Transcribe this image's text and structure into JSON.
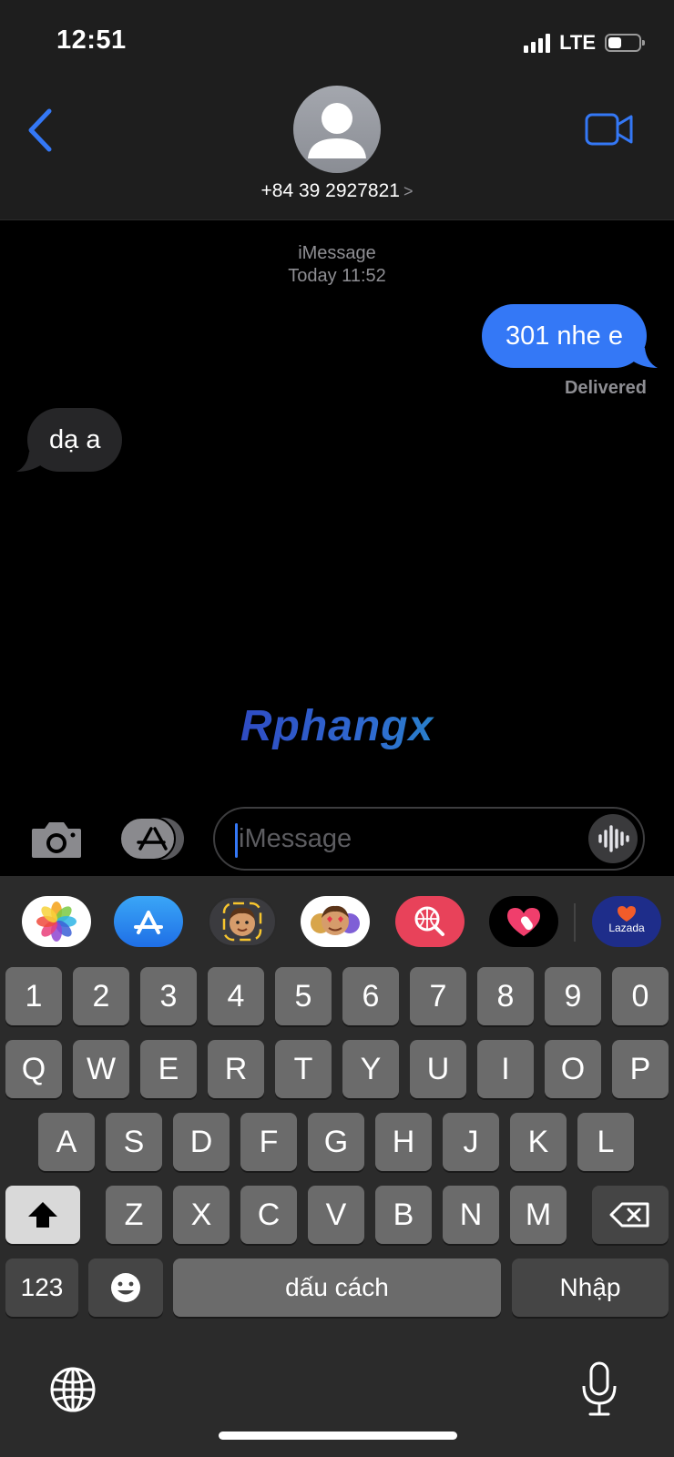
{
  "status_bar": {
    "time": "12:51",
    "network": "LTE"
  },
  "header": {
    "contact_number": "+84 39 2927821",
    "chevron": ">",
    "icons": [
      "back-chevron-icon",
      "video-call-icon",
      "contact-avatar-icon"
    ]
  },
  "conversation": {
    "service": "iMessage",
    "timestamp": "Today 11:52",
    "messages": [
      {
        "direction": "outgoing",
        "text": "301 nhe e",
        "status": "Delivered"
      },
      {
        "direction": "incoming",
        "text": "dạ a"
      }
    ],
    "watermark": "Rphangx"
  },
  "composer": {
    "placeholder": "iMessage",
    "icons": [
      "camera-icon",
      "app-store-icon",
      "audio-waveform-icon"
    ]
  },
  "app_strip": {
    "apps": [
      {
        "name": "photos",
        "label": ""
      },
      {
        "name": "app-store",
        "label": ""
      },
      {
        "name": "memoji",
        "label": ""
      },
      {
        "name": "memoji-stickers",
        "label": ""
      },
      {
        "name": "web-images",
        "label": ""
      },
      {
        "name": "digital-touch",
        "label": ""
      },
      {
        "name": "lazada",
        "label": "Lazada"
      }
    ]
  },
  "keyboard": {
    "row_numbers": [
      "1",
      "2",
      "3",
      "4",
      "5",
      "6",
      "7",
      "8",
      "9",
      "0"
    ],
    "row_top": [
      "Q",
      "W",
      "E",
      "R",
      "T",
      "Y",
      "U",
      "I",
      "O",
      "P"
    ],
    "row_middle": [
      "A",
      "S",
      "D",
      "F",
      "G",
      "H",
      "J",
      "K",
      "L"
    ],
    "row_bottom": [
      "Z",
      "X",
      "C",
      "V",
      "B",
      "N",
      "M"
    ],
    "numbers_key": "123",
    "space_key": "dấu cách",
    "return_key": "Nhập",
    "icons": [
      "shift-icon",
      "backspace-icon",
      "emoji-icon",
      "globe-icon",
      "microphone-icon"
    ]
  },
  "colors": {
    "accent": "#3478f6",
    "outgoing_bubble": "#3478f6",
    "incoming_bubble": "#262628",
    "keyboard_bg": "#2b2b2b",
    "key": "#6b6b6b"
  }
}
